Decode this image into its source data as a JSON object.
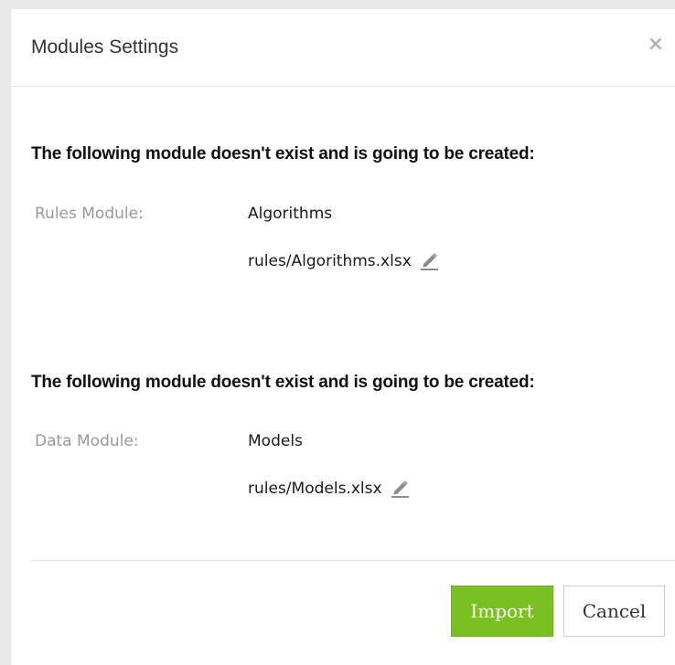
{
  "dialog": {
    "title": "Modules Settings",
    "close_label": "×"
  },
  "sections": [
    {
      "heading": "The following module doesn't exist and is going to be created:",
      "label": "Rules Module:",
      "name": "Algorithms",
      "path": "rules/Algorithms.xlsx",
      "edit_icon": "pencil-icon"
    },
    {
      "heading": "The following module doesn't exist and is going to be created:",
      "label": "Data Module:",
      "name": "Models",
      "path": "rules/Models.xlsx",
      "edit_icon": "pencil-icon"
    }
  ],
  "footer": {
    "import_label": "Import",
    "cancel_label": "Cancel"
  },
  "colors": {
    "primary_button": "#79c121",
    "heading_text": "#111111",
    "label_text": "#999999"
  }
}
